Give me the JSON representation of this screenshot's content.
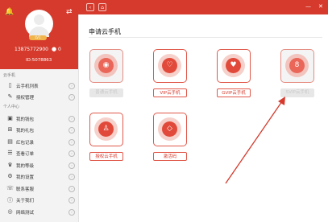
{
  "profile": {
    "level_badge": "LV1",
    "phone": "13875772900",
    "coins": "0",
    "id_label": "ID:5078863"
  },
  "sidebar": {
    "section_cloud": "云手机",
    "cloud_items": [
      {
        "label": "云手机列表",
        "icon": "phone-list-icon"
      },
      {
        "label": "授权管理",
        "icon": "authorize-icon"
      }
    ],
    "section_personal": "个人中心",
    "personal_items": [
      {
        "label": "我的钱包",
        "icon": "wallet-icon"
      },
      {
        "label": "我的礼包",
        "icon": "gift-icon"
      },
      {
        "label": "红包记录",
        "icon": "red-packet-icon"
      },
      {
        "label": "查看订单",
        "icon": "order-icon"
      },
      {
        "label": "我的等级",
        "icon": "level-icon"
      },
      {
        "label": "我的设置",
        "icon": "settings-icon"
      },
      {
        "label": "联系客服",
        "icon": "support-icon"
      },
      {
        "label": "关于我们",
        "icon": "info-icon"
      },
      {
        "label": "网络测试",
        "icon": "network-icon"
      }
    ]
  },
  "topbar": {
    "back": "‹",
    "home": "⌂",
    "minimize": "—",
    "close": "✕"
  },
  "main": {
    "title": "申请云手机",
    "cards": [
      {
        "label": "普通云手机",
        "glyph": "◉",
        "state": "disabled"
      },
      {
        "label": "VIP云手机",
        "glyph": "♡",
        "state": "active"
      },
      {
        "label": "GVIP云手机",
        "glyph": "♥",
        "state": "active"
      },
      {
        "label": "SVIP云手机",
        "glyph": "8",
        "state": "disabled"
      },
      {
        "label": "授权云手机",
        "glyph": "♙",
        "state": "active"
      },
      {
        "label": "激活码",
        "glyph": "◇",
        "state": "active"
      }
    ]
  },
  "colors": {
    "brand_red": "#d53a2c",
    "card_border": "#e0584a",
    "card_inner": "#f6d1cb"
  }
}
